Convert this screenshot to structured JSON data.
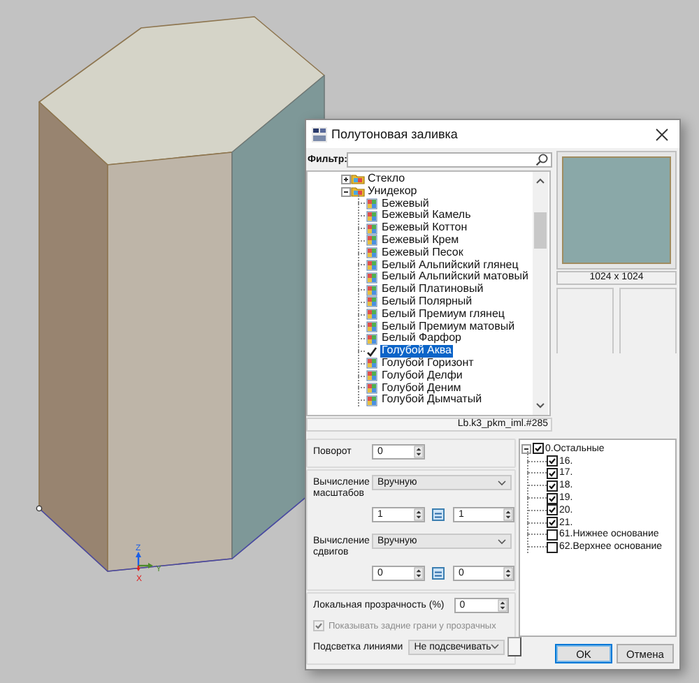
{
  "viewport": {
    "axes": [
      {
        "kind": "z",
        "label": "Z"
      },
      {
        "kind": "y",
        "label": "Y"
      },
      {
        "kind": "x",
        "label": "X"
      }
    ]
  },
  "dialog": {
    "title": "Полутоновая заливка"
  },
  "filter": {
    "label": "Фильтр:"
  },
  "materials": [
    {
      "label": "Стекло",
      "expanded": false
    },
    {
      "label": "Унидекор",
      "expanded": true,
      "children": [
        {
          "label": "Бежевый",
          "selected": false
        },
        {
          "label": "Бежевый Камель",
          "selected": false
        },
        {
          "label": "Бежевый Коттон",
          "selected": false
        },
        {
          "label": "Бежевый Крем",
          "selected": false
        },
        {
          "label": "Бежевый Песок",
          "selected": false
        },
        {
          "label": "Белый Альпийский глянец",
          "selected": false
        },
        {
          "label": "Белый Альпийский матовый",
          "selected": false
        },
        {
          "label": "Белый Платиновый",
          "selected": false
        },
        {
          "label": "Белый Полярный",
          "selected": false
        },
        {
          "label": "Белый Премиум глянец",
          "selected": false
        },
        {
          "label": "Белый Премиум матовый",
          "selected": false
        },
        {
          "label": "Белый Фарфор",
          "selected": false
        },
        {
          "label": "Голубой Аква",
          "selected": true
        },
        {
          "label": "Голубой Горизонт",
          "selected": false
        },
        {
          "label": "Голубой Делфи",
          "selected": false
        },
        {
          "label": "Голубой Деним",
          "selected": false
        },
        {
          "label": "Голубой Дымчатый",
          "selected": false
        }
      ]
    }
  ],
  "path": "Lb.k3_pkm_iml.#285",
  "preview": {
    "size": "1024 x 1024"
  },
  "params": {
    "rotation": {
      "label": "Поворот",
      "value": "0"
    },
    "scale": {
      "label": "Вычисление масштабов",
      "mode": "Вручную",
      "values": [
        "1",
        "1"
      ],
      "linked": true
    },
    "offset": {
      "label": "Вычисление сдвигов",
      "mode": "Вручную",
      "values": [
        "0",
        "0"
      ],
      "linked": true
    },
    "transparency": {
      "label": "Локальная прозрачность (%)",
      "value": "0"
    },
    "back_faces": {
      "label": "Показывать задние грани у прозрачных",
      "checked": true,
      "disabled": true
    },
    "highlight": {
      "label": "Подсветка линиями",
      "mode": "Не подсвечивать"
    }
  },
  "faces": [
    {
      "label": "0.Остальные",
      "checked": true,
      "expanded": true,
      "children": [
        {
          "label": "16.",
          "checked": true
        },
        {
          "label": "17.",
          "checked": true
        },
        {
          "label": "18.",
          "checked": true
        },
        {
          "label": "19.",
          "checked": true
        },
        {
          "label": "20.",
          "checked": true
        },
        {
          "label": "21.",
          "checked": true
        },
        {
          "label": "61.Нижнее основание",
          "checked": false
        },
        {
          "label": "62.Верхнее основание",
          "checked": false
        }
      ]
    }
  ],
  "buttons": [
    {
      "label": "OK",
      "default": true
    },
    {
      "label": "Отмена",
      "default": false
    }
  ]
}
